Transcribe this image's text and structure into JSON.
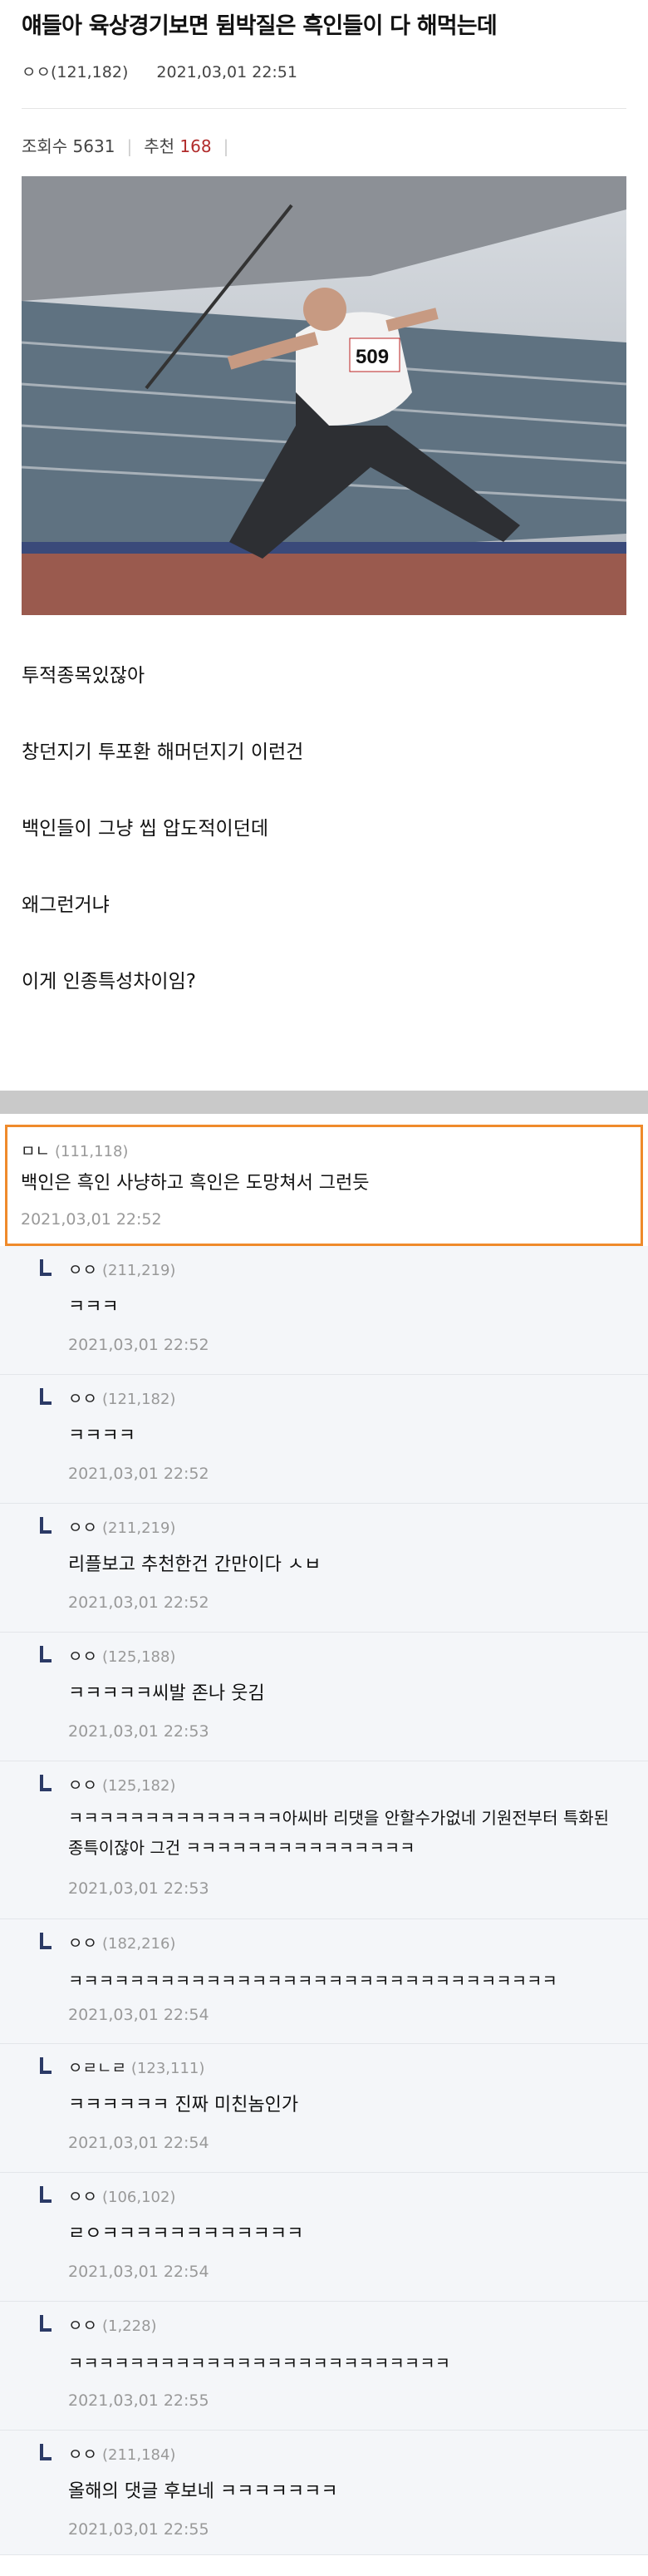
{
  "post": {
    "title": "얘들아 육상경기보면 뒴박질은 흑인들이 다 해먹는데",
    "author": "ㅇㅇ(121,182)",
    "datetime": "2021,03,01 22:51",
    "views_label": "조회수 5631",
    "recommend_label": "추천",
    "recommend_count": "168",
    "image_alt": "javelin thrower, bib 509",
    "body": [
      "투적종목있잖아",
      "창던지기 투포환 해머던지기 이런건",
      "백인들이 그냥 씹 압도적이던데",
      "왜그런거냐",
      "이게 인종특성차이임?"
    ]
  },
  "comments": [
    {
      "user": "ㅁㄴ",
      "ip": "(111,118)",
      "text": "백인은 흑인 사냥하고 흑인은 도망쳐서 그런듯",
      "date": "2021,03,01 22:52",
      "top": true
    },
    {
      "user": "ㅇㅇ",
      "ip": "(211,219)",
      "text": "ㅋㅋㅋ",
      "date": "2021,03,01 22:52"
    },
    {
      "user": "ㅇㅇ",
      "ip": "(121,182)",
      "text": "ㅋㅋㅋㅋ",
      "date": "2021,03,01 22:52"
    },
    {
      "user": "ㅇㅇ",
      "ip": "(211,219)",
      "text": "리플보고 추천한건 간만이다 ㅅㅂ",
      "date": "2021,03,01 22:52"
    },
    {
      "user": "ㅇㅇ",
      "ip": "(125,188)",
      "text": "ㅋㅋㅋㅋㅋ씨발 존나 웃김",
      "date": "2021,03,01 22:53"
    },
    {
      "user": "ㅇㅇ",
      "ip": "(125,182)",
      "text": "ㅋㅋㅋㅋㅋㅋㅋㅋㅋㅋㅋㅋㅋㅋ아씨바 리댓을 안할수가없네 기원전부터 특화된 종특이잖아 그건 ㅋㅋㅋㅋㅋㅋㅋㅋㅋㅋㅋㅋㅋㅋㅋ",
      "date": "2021,03,01 22:53"
    },
    {
      "user": "ㅇㅇ",
      "ip": "(182,216)",
      "text": "ㅋㅋㅋㅋㅋㅋㅋㅋㅋㅋㅋㅋㅋㅋㅋㅋㅋㅋㅋㅋㅋㅋㅋㅋㅋㅋㅋㅋㅋㅋㅋㅋ",
      "date": "2021,03,01 22:54"
    },
    {
      "user": "ㅇㄹㄴㄹ",
      "ip": "(123,111)",
      "text": "ㅋㅋㅋㅋㅋㅋ 진짜 미친놈인가",
      "date": "2021,03,01 22:54"
    },
    {
      "user": "ㅇㅇ",
      "ip": "(106,102)",
      "text": "ㄹㅇㅋㅋㅋㅋㅋㅋㅋㅋㅋㅋㅋㅋ",
      "date": "2021,03,01 22:54"
    },
    {
      "user": "ㅇㅇ",
      "ip": "(1,228)",
      "text": "ㅋㅋㅋㅋㅋㅋㅋㅋㅋㅋㅋㅋㅋㅋㅋㅋㅋㅋㅋㅋㅋㅋㅋㅋㅋ",
      "date": "2021,03,01 22:55"
    },
    {
      "user": "ㅇㅇ",
      "ip": "(211,184)",
      "text": "올해의 댓글 후보네 ㅋㅋㅋㅋㅋㅋㅋ",
      "date": "2021,03,01 22:55"
    }
  ],
  "colors": {
    "accent": "#ef8a2b",
    "recommend": "#b12b2b",
    "reply_mark": "#2b3a66"
  }
}
